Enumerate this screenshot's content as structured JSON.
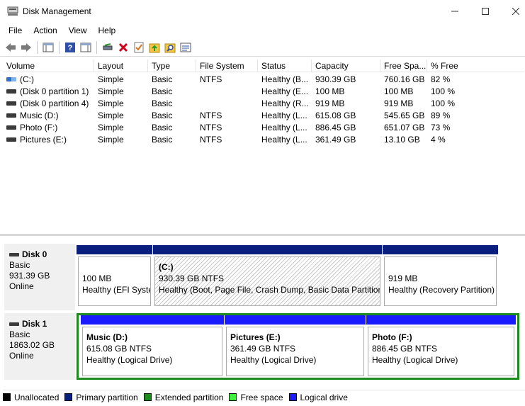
{
  "window": {
    "title": "Disk Management"
  },
  "menu": [
    "File",
    "Action",
    "View",
    "Help"
  ],
  "toolbar_icons": [
    "back-arrow-icon",
    "forward-arrow-icon",
    "show-hide-console-tree-icon",
    "help-icon",
    "show-hide-action-pane-icon",
    "connect-drive-icon",
    "delete-icon",
    "properties-check-icon",
    "export-list-icon",
    "search-icon",
    "properties-icon"
  ],
  "volume_list": {
    "columns": [
      "Volume",
      "Layout",
      "Type",
      "File System",
      "Status",
      "Capacity",
      "Free Spa...",
      "% Free"
    ],
    "rows": [
      [
        "(C:)",
        "Simple",
        "Basic",
        "NTFS",
        "Healthy (B...",
        "930.39 GB",
        "760.16 GB",
        "82 %"
      ],
      [
        "(Disk 0 partition 1)",
        "Simple",
        "Basic",
        "",
        "Healthy (E...",
        "100 MB",
        "100 MB",
        "100 %"
      ],
      [
        "(Disk 0 partition 4)",
        "Simple",
        "Basic",
        "",
        "Healthy (R...",
        "919 MB",
        "919 MB",
        "100 %"
      ],
      [
        "Music (D:)",
        "Simple",
        "Basic",
        "NTFS",
        "Healthy (L...",
        "615.08 GB",
        "545.65 GB",
        "89 %"
      ],
      [
        "Photo (F:)",
        "Simple",
        "Basic",
        "NTFS",
        "Healthy (L...",
        "886.45 GB",
        "651.07 GB",
        "73 %"
      ],
      [
        "Pictures (E:)",
        "Simple",
        "Basic",
        "NTFS",
        "Healthy (L...",
        "361.49 GB",
        "13.10 GB",
        "4 %"
      ]
    ]
  },
  "disks": [
    {
      "name": "Disk 0",
      "type": "Basic",
      "size": "931.39 GB",
      "status": "Online",
      "partitions": [
        {
          "label": "",
          "size": "100 MB",
          "status": "Healthy (EFI Syste",
          "kind": "primary"
        },
        {
          "label": "(C:)",
          "size": "930.39 GB NTFS",
          "status": "Healthy (Boot, Page File, Crash Dump, Basic Data Partition)",
          "kind": "primary-selected"
        },
        {
          "label": "",
          "size": "919 MB",
          "status": "Healthy (Recovery Partition)",
          "kind": "primary"
        }
      ]
    },
    {
      "name": "Disk 1",
      "type": "Basic",
      "size": "1863.02 GB",
      "status": "Online",
      "partitions": [
        {
          "label": "Music  (D:)",
          "size": "615.08 GB NTFS",
          "status": "Healthy (Logical Drive)",
          "kind": "logical"
        },
        {
          "label": "Pictures  (E:)",
          "size": "361.49 GB NTFS",
          "status": "Healthy (Logical Drive)",
          "kind": "logical"
        },
        {
          "label": "Photo  (F:)",
          "size": "886.45 GB NTFS",
          "status": "Healthy (Logical Drive)",
          "kind": "logical"
        }
      ]
    }
  ],
  "legend": [
    {
      "label": "Unallocated",
      "color": "#000000"
    },
    {
      "label": "Primary partition",
      "color": "#0a1f7d"
    },
    {
      "label": "Extended partition",
      "color": "#1c8a1c"
    },
    {
      "label": "Free space",
      "color": "#3df03d"
    },
    {
      "label": "Logical drive",
      "color": "#1a1aff"
    }
  ],
  "colors": {
    "primary_bar": "#0a1f7d",
    "logical_bar": "#1a1aff",
    "extended_frame": "#1c8a1c"
  }
}
